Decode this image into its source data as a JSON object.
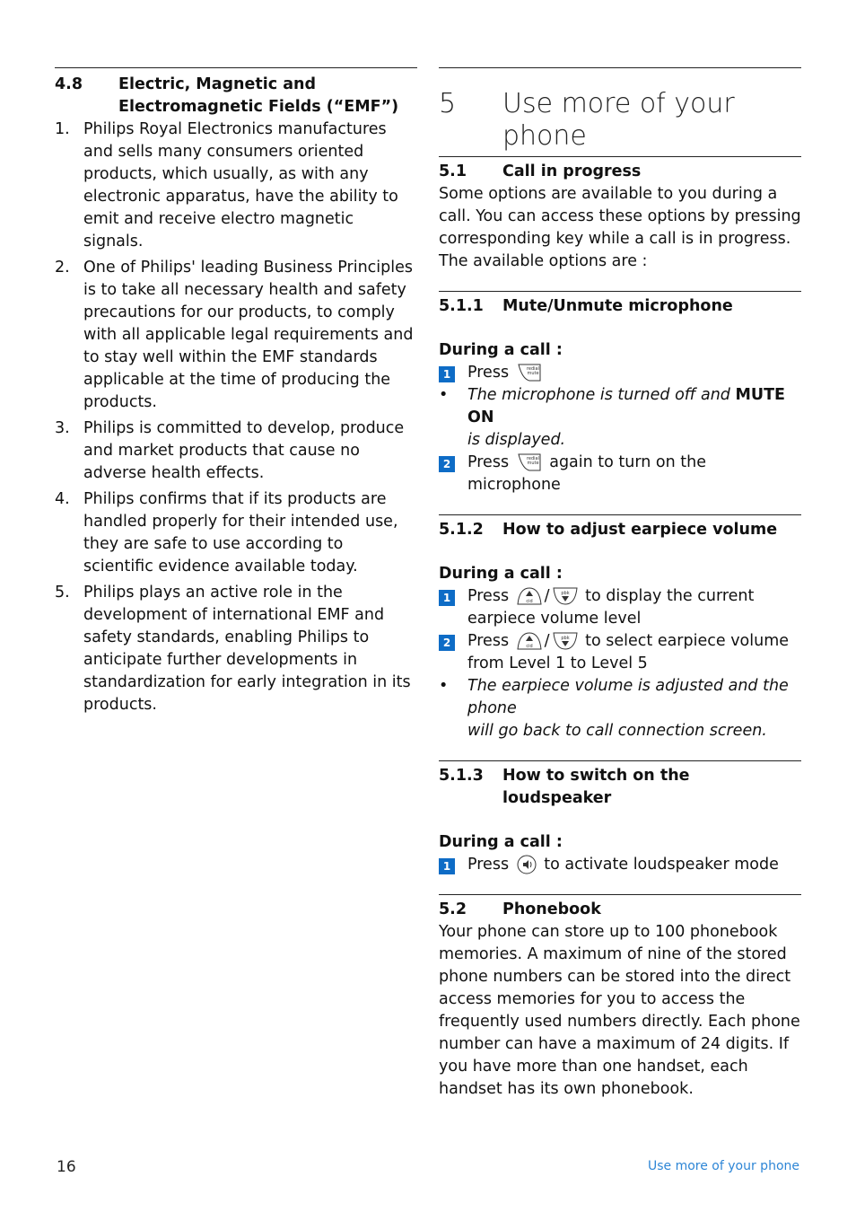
{
  "left": {
    "section": {
      "number": "4.8",
      "title_line1": "Electric, Magnetic and",
      "title_line2": "Electromagnetic Fields (“EMF”)"
    },
    "items": [
      {
        "n": "1.",
        "text": "Philips Royal Electronics manufactures and sells many consumers oriented products, which usually, as with any electronic apparatus, have the ability to emit and receive electro magnetic signals."
      },
      {
        "n": "2.",
        "text": "One of Philips' leading Business Principles is to take all necessary health and safety precautions for our products, to comply with all applicable legal requirements and to stay well within the EMF standards applicable at the time of producing the products."
      },
      {
        "n": "3.",
        "text": "Philips is committed to develop, produce and market products that cause no adverse health effects."
      },
      {
        "n": "4.",
        "text": "Philips confirms that if its products are handled properly for their intended use, they are safe to use according to scientific evidence available today."
      },
      {
        "n": "5.",
        "text": "Philips plays an active role in the development of international EMF and safety standards, enabling Philips to anticipate further developments in standardization for early integration in its products."
      }
    ]
  },
  "right": {
    "chapter": {
      "number": "5",
      "title": "Use more of your phone"
    },
    "s51": {
      "number": "5.1",
      "title": "Call in progress",
      "body": "Some options are available to you during a call. You can access these options by pressing corresponding key while a call is in progress. The available options are :"
    },
    "s511": {
      "number": "5.1.1",
      "title": "Mute/Unmute microphone",
      "during": "During a call :",
      "step1": {
        "badge": "1",
        "press": "Press",
        "icon": "redial-mute-key-icon"
      },
      "bullet": {
        "text": "The microphone is turned off and ",
        "bold": "MUTE ON",
        "text2": "is displayed."
      },
      "step2": {
        "badge": "2",
        "press": "Press",
        "icon": "redial-mute-key-icon",
        "rest": "again to turn on the microphone"
      }
    },
    "s512": {
      "number": "5.1.2",
      "title": "How to adjust earpiece volume",
      "during": "During a call :",
      "step1": {
        "badge": "1",
        "press": "Press",
        "rest": "to display the current",
        "rest2": "earpiece volume level"
      },
      "step2": {
        "badge": "2",
        "press": "Press",
        "rest": "to select earpiece volume",
        "rest2": "from Level 1 to Level 5"
      },
      "bullet": {
        "line1": "The earpiece volume is adjusted and the phone",
        "line2": "will go back to call connection screen."
      },
      "icon_sep": "/"
    },
    "s513": {
      "number": "5.1.3",
      "title": "How to switch on the loudspeaker",
      "during": "During a call :",
      "step1": {
        "badge": "1",
        "press": "Press",
        "rest": "to activate loudspeaker mode"
      }
    },
    "s52": {
      "number": "5.2",
      "title": "Phonebook",
      "body": "Your phone can store up to 100 phonebook memories. A maximum of nine of the stored phone numbers can be stored into the direct access memories for you to access the frequently used numbers directly. Each phone number can have a maximum of 24 digits. If you have more than one handset, each handset has its own phonebook."
    }
  },
  "footer": {
    "page_number": "16",
    "section_title": "Use more of your phone"
  },
  "colors": {
    "accent": "#0e6cc6",
    "footer_text": "#2e86d6"
  }
}
